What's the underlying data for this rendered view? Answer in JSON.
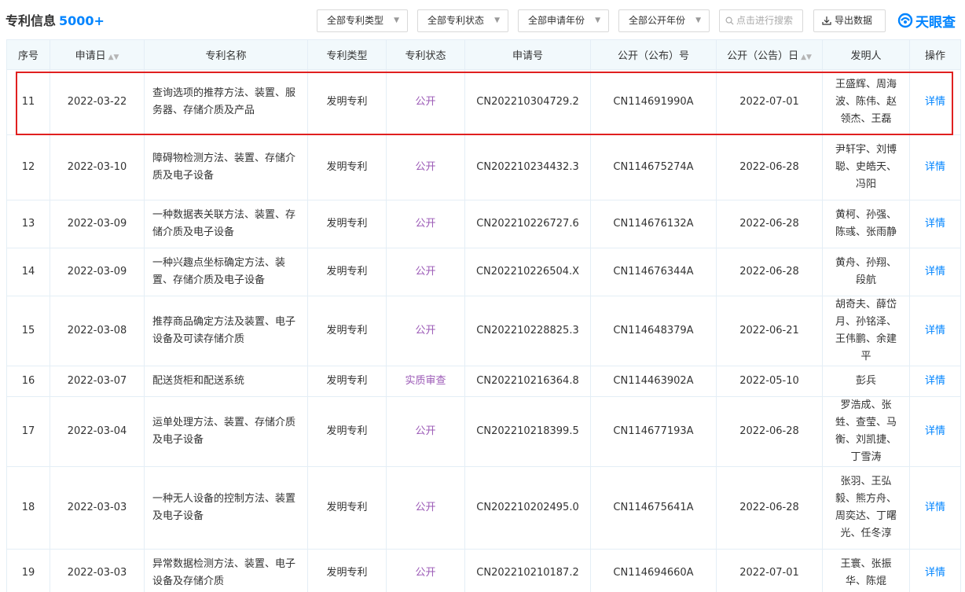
{
  "header": {
    "title": "专利信息",
    "count": "5000+",
    "filters": [
      "全部专利类型",
      "全部专利状态",
      "全部申请年份",
      "全部公开年份"
    ],
    "search_placeholder": "点击进行搜索",
    "export_label": "导出数据",
    "logo_text": "天眼查"
  },
  "colors": {
    "accent": "#0084ff",
    "status": "#9b59b6",
    "highlight": "#e02020",
    "header_bg": "#f2f9fc"
  },
  "table": {
    "columns": [
      "序号",
      "申请日",
      "专利名称",
      "专利类型",
      "专利状态",
      "申请号",
      "公开（公布）号",
      "公开（公告）日",
      "发明人",
      "操作"
    ],
    "rows": [
      {
        "no": "11",
        "date": "2022-03-22",
        "name": "查询选项的推荐方法、装置、服务器、存储介质及产品",
        "type": "发明专利",
        "status": "公开",
        "app_no": "CN202210304729.2",
        "pub_no": "CN114691990A",
        "pub_date": "2022-07-01",
        "inventors": "王盛辉、周海波、陈伟、赵领杰、王磊",
        "action": "详情"
      },
      {
        "no": "12",
        "date": "2022-03-10",
        "name": "障碍物检测方法、装置、存储介质及电子设备",
        "type": "发明专利",
        "status": "公开",
        "app_no": "CN202210234432.3",
        "pub_no": "CN114675274A",
        "pub_date": "2022-06-28",
        "inventors": "尹轩宇、刘博聪、史皓天、冯阳",
        "action": "详情"
      },
      {
        "no": "13",
        "date": "2022-03-09",
        "name": "一种数据表关联方法、装置、存储介质及电子设备",
        "type": "发明专利",
        "status": "公开",
        "app_no": "CN202210226727.6",
        "pub_no": "CN114676132A",
        "pub_date": "2022-06-28",
        "inventors": "黄柯、孙强、陈彧、张雨静",
        "action": "详情"
      },
      {
        "no": "14",
        "date": "2022-03-09",
        "name": "一种兴趣点坐标确定方法、装置、存储介质及电子设备",
        "type": "发明专利",
        "status": "公开",
        "app_no": "CN202210226504.X",
        "pub_no": "CN114676344A",
        "pub_date": "2022-06-28",
        "inventors": "黄舟、孙翔、段航",
        "action": "详情"
      },
      {
        "no": "15",
        "date": "2022-03-08",
        "name": "推荐商品确定方法及装置、电子设备及可读存储介质",
        "type": "发明专利",
        "status": "公开",
        "app_no": "CN202210228825.3",
        "pub_no": "CN114648379A",
        "pub_date": "2022-06-21",
        "inventors": "胡奇夫、薛岱月、孙铭泽、王伟鹏、余建平",
        "action": "详情"
      },
      {
        "no": "16",
        "date": "2022-03-07",
        "name": "配送货柜和配送系统",
        "type": "发明专利",
        "status": "实质审查",
        "app_no": "CN202210216364.8",
        "pub_no": "CN114463902A",
        "pub_date": "2022-05-10",
        "inventors": "彭兵",
        "action": "详情"
      },
      {
        "no": "17",
        "date": "2022-03-04",
        "name": "运单处理方法、装置、存储介质及电子设备",
        "type": "发明专利",
        "status": "公开",
        "app_no": "CN202210218399.5",
        "pub_no": "CN114677193A",
        "pub_date": "2022-06-28",
        "inventors": "罗浩成、张甡、查莹、马衡、刘凯捷、丁雪涛",
        "action": "详情"
      },
      {
        "no": "18",
        "date": "2022-03-03",
        "name": "一种无人设备的控制方法、装置及电子设备",
        "type": "发明专利",
        "status": "公开",
        "app_no": "CN202210202495.0",
        "pub_no": "CN114675641A",
        "pub_date": "2022-06-28",
        "inventors": "张羽、王弘毅、熊方舟、周奕达、丁曙光、任冬淳",
        "action": "详情"
      },
      {
        "no": "19",
        "date": "2022-03-03",
        "name": "异常数据检测方法、装置、电子设备及存储介质",
        "type": "发明专利",
        "status": "公开",
        "app_no": "CN202210210187.2",
        "pub_no": "CN114694660A",
        "pub_date": "2022-07-01",
        "inventors": "王寰、张振华、陈焜",
        "action": "详情"
      }
    ]
  }
}
